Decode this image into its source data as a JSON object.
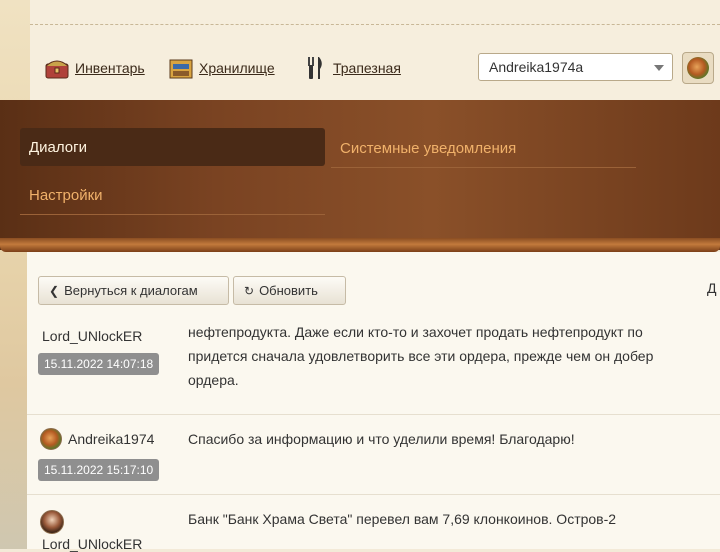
{
  "topnav": {
    "inventory": "Инвентарь",
    "storage": "Хранилище",
    "dining": "Трапезная"
  },
  "user_select": {
    "value": "Andreika1974a"
  },
  "tabs": {
    "dialogs": "Диалоги",
    "system": "Системные уведомления",
    "settings": "Настройки"
  },
  "toolbar": {
    "back": "Вернуться к диалогам",
    "refresh": "Обновить",
    "right_cut": "Д"
  },
  "messages": [
    {
      "author": "Lord_UNlockER",
      "date": "15.11.2022 14:07:18",
      "lines": [
        "нефтепродукта. Даже если кто-то и захочет продать нефтепродукт по",
        "придется сначала удовлетворить все эти ордера, прежде чем он добер",
        "ордера."
      ]
    },
    {
      "author": "Andreika1974",
      "date": "15.11.2022 15:17:10",
      "lines": [
        "Спасибо за информацию и что уделили время! Благодарю!"
      ]
    },
    {
      "author": "Lord_UNlockER",
      "date": "",
      "lines": [
        "Банк \"Банк Храма Света\" перевел вам 7,69 клонкоинов. Остров-2"
      ]
    }
  ],
  "icons": {
    "inventory": "chest-icon",
    "storage": "storage-icon",
    "dining": "fork-knife-icon",
    "avatar": "avatar-icon",
    "back": "chevron-left-icon",
    "refresh": "refresh-icon"
  }
}
